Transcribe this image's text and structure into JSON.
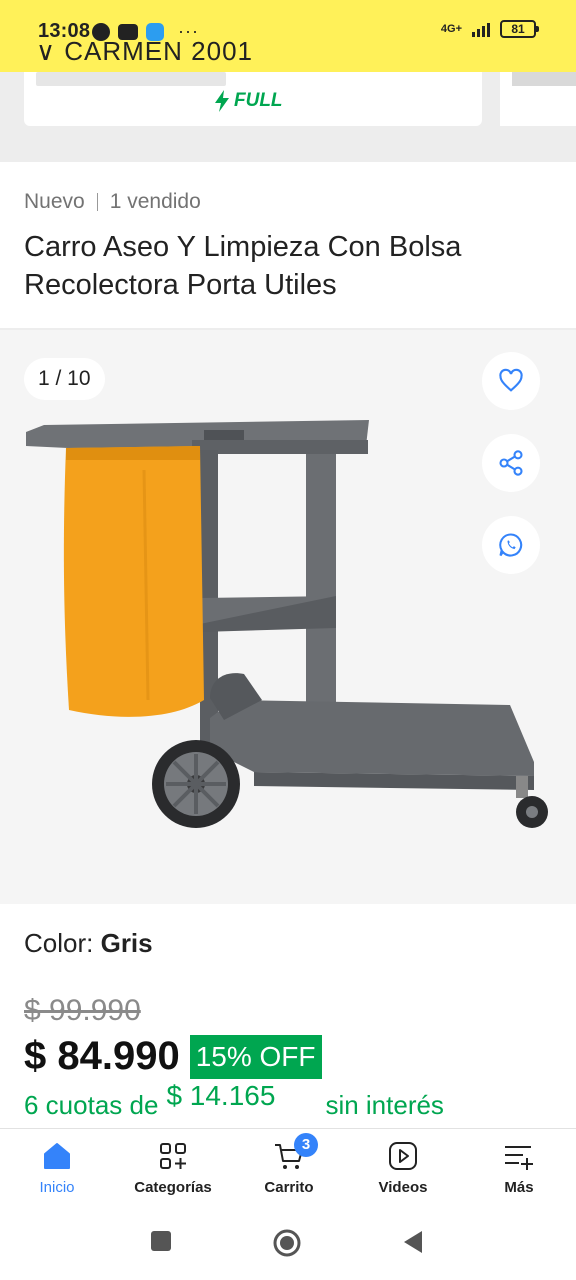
{
  "status": {
    "time": "13:08",
    "network": "4G+",
    "battery": "81"
  },
  "seller_partial": "∨ CARMEN 2001",
  "shipping_badge": "FULL",
  "product": {
    "condition": "Nuevo",
    "sold": "1 vendido",
    "title": "Carro Aseo Y Limpieza Con Bolsa Recolectora Porta Utiles"
  },
  "gallery": {
    "counter": "1 / 10",
    "actions": [
      "heart-icon",
      "share-icon",
      "whatsapp-icon"
    ]
  },
  "details": {
    "color_label": "Color:",
    "color_value": "Gris",
    "old_price": "$ 99.990",
    "price": "$ 84.990",
    "discount": "15% OFF",
    "installments_prefix": "6 cuotas de",
    "installments_amount": "$ 14.165",
    "installments_suffix": "sin interés"
  },
  "bottom_nav": {
    "items": [
      {
        "label": "Inicio",
        "icon": "home-icon",
        "active": true
      },
      {
        "label": "Categorías",
        "icon": "categories-icon"
      },
      {
        "label": "Carrito",
        "icon": "cart-icon",
        "badge": "3"
      },
      {
        "label": "Videos",
        "icon": "video-icon"
      },
      {
        "label": "Más",
        "icon": "menu-plus-icon"
      }
    ]
  },
  "colors": {
    "brand_yellow": "#fff159",
    "accent_blue": "#3483fa",
    "success_green": "#00a650"
  }
}
